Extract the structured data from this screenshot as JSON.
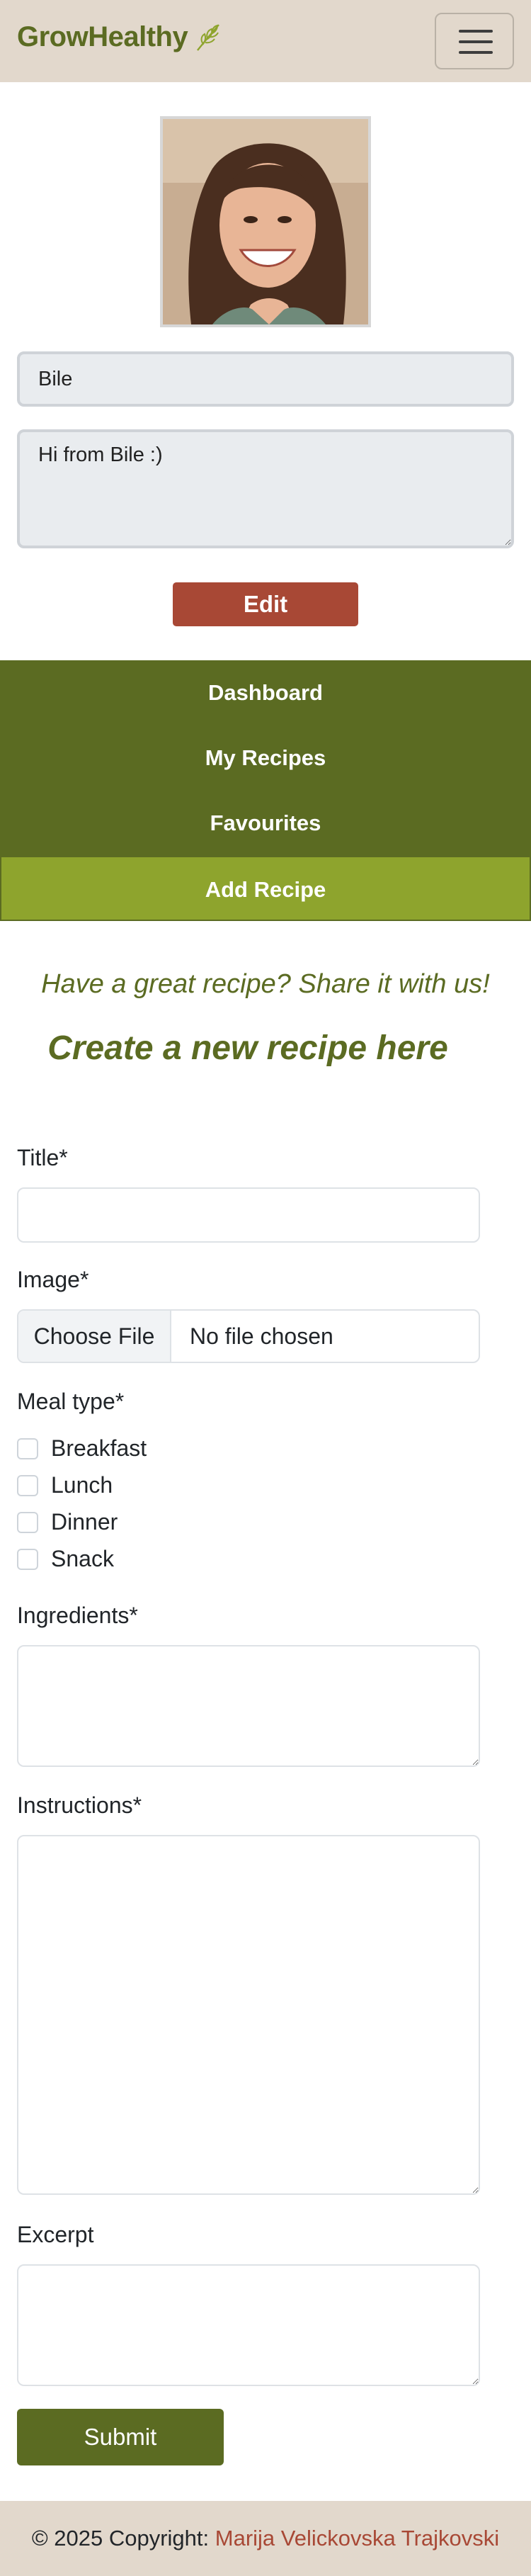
{
  "navbar": {
    "brand": "GrowHealthy",
    "leaf_icon": "leaf-icon",
    "menu_icon": "hamburger-menu-icon"
  },
  "profile": {
    "name_value": "Bile",
    "bio_value": "Hi from Bile :)",
    "edit_label": "Edit"
  },
  "sidenav": {
    "items": [
      {
        "label": "Dashboard",
        "active": false
      },
      {
        "label": "My Recipes",
        "active": false
      },
      {
        "label": "Favourites",
        "active": false
      },
      {
        "label": "Add Recipe",
        "active": true
      }
    ]
  },
  "form": {
    "tagline": "Have a great recipe? Share it with us!",
    "heading": "Create a new recipe here",
    "title_label": "Title*",
    "image_label": "Image*",
    "file_button": "Choose File",
    "file_status": "No file chosen",
    "meal_type_label": "Meal type*",
    "meal_types": [
      "Breakfast",
      "Lunch",
      "Dinner",
      "Snack"
    ],
    "ingredients_label": "Ingredients*",
    "instructions_label": "Instructions*",
    "excerpt_label": "Excerpt",
    "submit_label": "Submit"
  },
  "footer": {
    "prefix": "© 2025 Copyright: ",
    "author": "Marija Velickovska Trajkovski"
  },
  "colors": {
    "brand_green": "#5b6b22",
    "active_green": "#8ea42d",
    "accent_red": "#a84835",
    "beige": "#e2d8cc"
  }
}
